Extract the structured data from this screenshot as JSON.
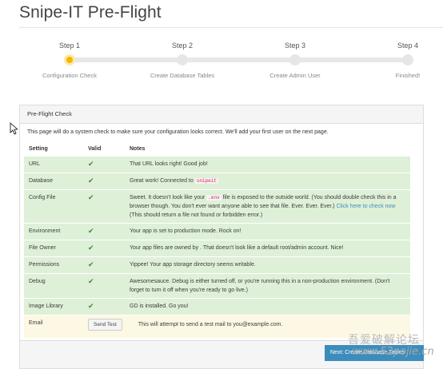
{
  "page": {
    "title": "Snipe-IT Pre-Flight"
  },
  "steps": [
    {
      "title": "Step 1",
      "subtitle": "Configuration Check",
      "state": "active"
    },
    {
      "title": "Step 2",
      "subtitle": "Create Database Tables",
      "state": "pending"
    },
    {
      "title": "Step 3",
      "subtitle": "Create Admin User",
      "state": "pending"
    },
    {
      "title": "Step 4",
      "subtitle": "Finished!",
      "state": "pending"
    }
  ],
  "panel": {
    "heading": "Pre-Flight Check",
    "intro": "This page will do a system check to make sure your configuration looks correct. We'll add your first user on the next page.",
    "columns": [
      "Setting",
      "Valid",
      "Notes"
    ],
    "rows": [
      {
        "setting": "URL",
        "valid": "✔",
        "notes": "That URL looks right! Good job!"
      },
      {
        "setting": "Database",
        "valid": "✔",
        "notes_pre": "Great work! Connected to ",
        "notes_code": "snipeit"
      },
      {
        "setting": "Config File",
        "valid": "✔",
        "notes_pre": "Sweet. It doesn't look like your ",
        "notes_code": ".env",
        "notes_post": " file is exposed to the outside world. (You should double check this in a browser though. You don't ever want anyone able to see that file. Ever. Ever. Ever.) ",
        "notes_link": "Click here to check now",
        "notes_tail": " (This should return a file not found or forbidden error.)"
      },
      {
        "setting": "Environment",
        "valid": "✔",
        "notes": "Your app is set to production mode. Rock on!"
      },
      {
        "setting": "File Owner",
        "valid": "✔",
        "notes": "Your app files are owned by  . That doesn't look like a default root/admin account. Nice!"
      },
      {
        "setting": "Permissions",
        "valid": "✔",
        "notes": "Yippee! Your app storage directory seems writable."
      },
      {
        "setting": "Debug",
        "valid": "✔",
        "notes": "Awesomesauce. Debug is either turned off, or you're running this in a non-production environment. (Don't forget to turn it off when you're ready to go live.)"
      },
      {
        "setting": "Image Library",
        "valid": "✔",
        "notes": "GD is installed. Go you!"
      }
    ],
    "email_row": {
      "setting": "Email",
      "button": "Send Test",
      "notes": "This will attempt to send a test mail to you@example.com."
    },
    "next_button": "Next: Create Database Tables"
  },
  "watermark": {
    "chinese": "吾爱破解论坛",
    "url": "www.52pojie.cn"
  },
  "colors": {
    "ok_row": "#dff0d8",
    "warn_row": "#fcf8e3",
    "primary": "#3c8dbc",
    "active_step": "#f6b500"
  }
}
